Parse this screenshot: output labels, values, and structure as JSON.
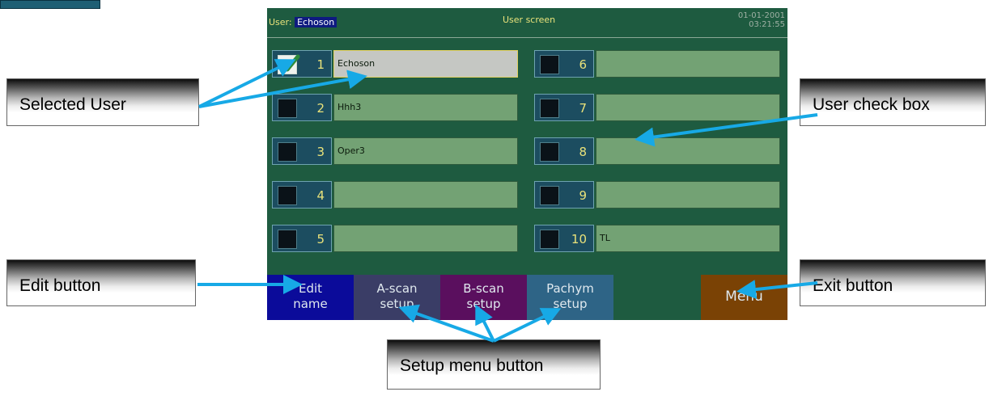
{
  "screen": {
    "user_label": "User:",
    "user_name": "Echoson",
    "title": "User screen",
    "date": "01-01-2001",
    "time": "03:21:55"
  },
  "users": [
    {
      "number": "1",
      "name": "Echoson",
      "checked": true
    },
    {
      "number": "2",
      "name": "Hhh3",
      "checked": false
    },
    {
      "number": "3",
      "name": "Oper3",
      "checked": false
    },
    {
      "number": "4",
      "name": "",
      "checked": false
    },
    {
      "number": "5",
      "name": "",
      "checked": false
    },
    {
      "number": "6",
      "name": "",
      "checked": false
    },
    {
      "number": "7",
      "name": "",
      "checked": false
    },
    {
      "number": "8",
      "name": "",
      "checked": false
    },
    {
      "number": "9",
      "name": "",
      "checked": false
    },
    {
      "number": "10",
      "name": "TL",
      "checked": false
    }
  ],
  "buttons": {
    "edit": {
      "line1": "Edit",
      "line2": "name",
      "color": "#0b0b9a"
    },
    "ascan": {
      "line1": "A-scan",
      "line2": "setup",
      "color": "#3a3d66"
    },
    "bscan": {
      "line1": "B-scan",
      "line2": "setup",
      "color": "#5a0f5e"
    },
    "pachym": {
      "line1": "Pachym",
      "line2": "setup",
      "color": "#2e6486"
    },
    "blank": {
      "color": "#1e5b40"
    },
    "menu": {
      "label": "Menu",
      "color": "#7a4205"
    }
  },
  "callouts": {
    "selected_user": "Selected  User",
    "user_check_box": "User check box",
    "edit_button": "Edit  button",
    "exit_button": "Exit button",
    "setup_menu_button": "Setup menu button"
  },
  "colors": {
    "screen_bg": "#1e5b40",
    "number_box": "#1c4d60",
    "name_field": "#73a274",
    "selected_field": "#c5c7c3",
    "accent_yellow": "#e9e27a",
    "arrow": "#17a9e6"
  }
}
